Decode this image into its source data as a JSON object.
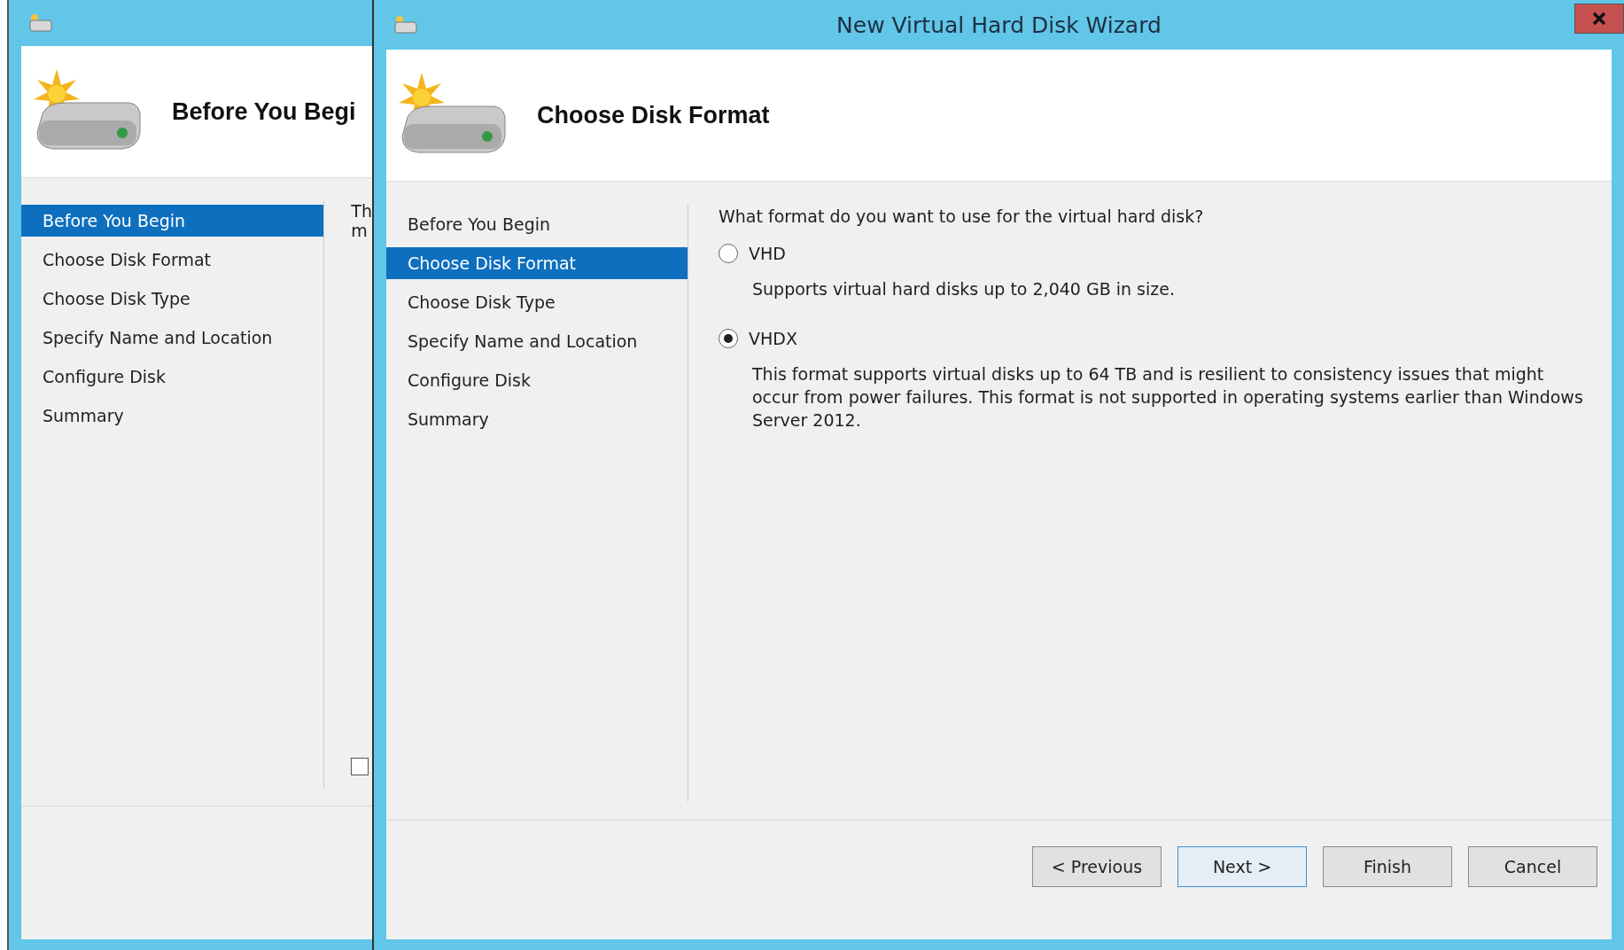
{
  "back_window": {
    "header_title": "Before You Begi",
    "steps": [
      {
        "label": "Before You Begin",
        "selected": true
      },
      {
        "label": "Choose Disk Format",
        "selected": false
      },
      {
        "label": "Choose Disk Type",
        "selected": false
      },
      {
        "label": "Specify Name and Location",
        "selected": false
      },
      {
        "label": "Configure Disk",
        "selected": false
      },
      {
        "label": "Summary",
        "selected": false
      }
    ],
    "text_fragments": [
      "Th",
      "m"
    ],
    "checkbox": {
      "checked": false
    }
  },
  "front_window": {
    "title": "New Virtual Hard Disk Wizard",
    "header_title": "Choose Disk Format",
    "steps": [
      {
        "label": "Before You Begin",
        "selected": false
      },
      {
        "label": "Choose Disk Format",
        "selected": true
      },
      {
        "label": "Choose Disk Type",
        "selected": false
      },
      {
        "label": "Specify Name and Location",
        "selected": false
      },
      {
        "label": "Configure Disk",
        "selected": false
      },
      {
        "label": "Summary",
        "selected": false
      }
    ],
    "question": "What format do you want to use for the virtual hard disk?",
    "options": [
      {
        "label": "VHD",
        "description": "Supports virtual hard disks up to 2,040 GB in size.",
        "selected": false
      },
      {
        "label": "VHDX",
        "description": "This format supports virtual disks up to 64 TB and is resilient to consistency issues that might occur from power failures. This format is not supported in operating systems earlier than Windows Server 2012.",
        "selected": true
      }
    ],
    "buttons": [
      {
        "label": "< Previous",
        "default": false
      },
      {
        "label": "Next >",
        "default": true
      },
      {
        "label": "Finish",
        "default": false
      },
      {
        "label": "Cancel",
        "default": false
      }
    ]
  }
}
